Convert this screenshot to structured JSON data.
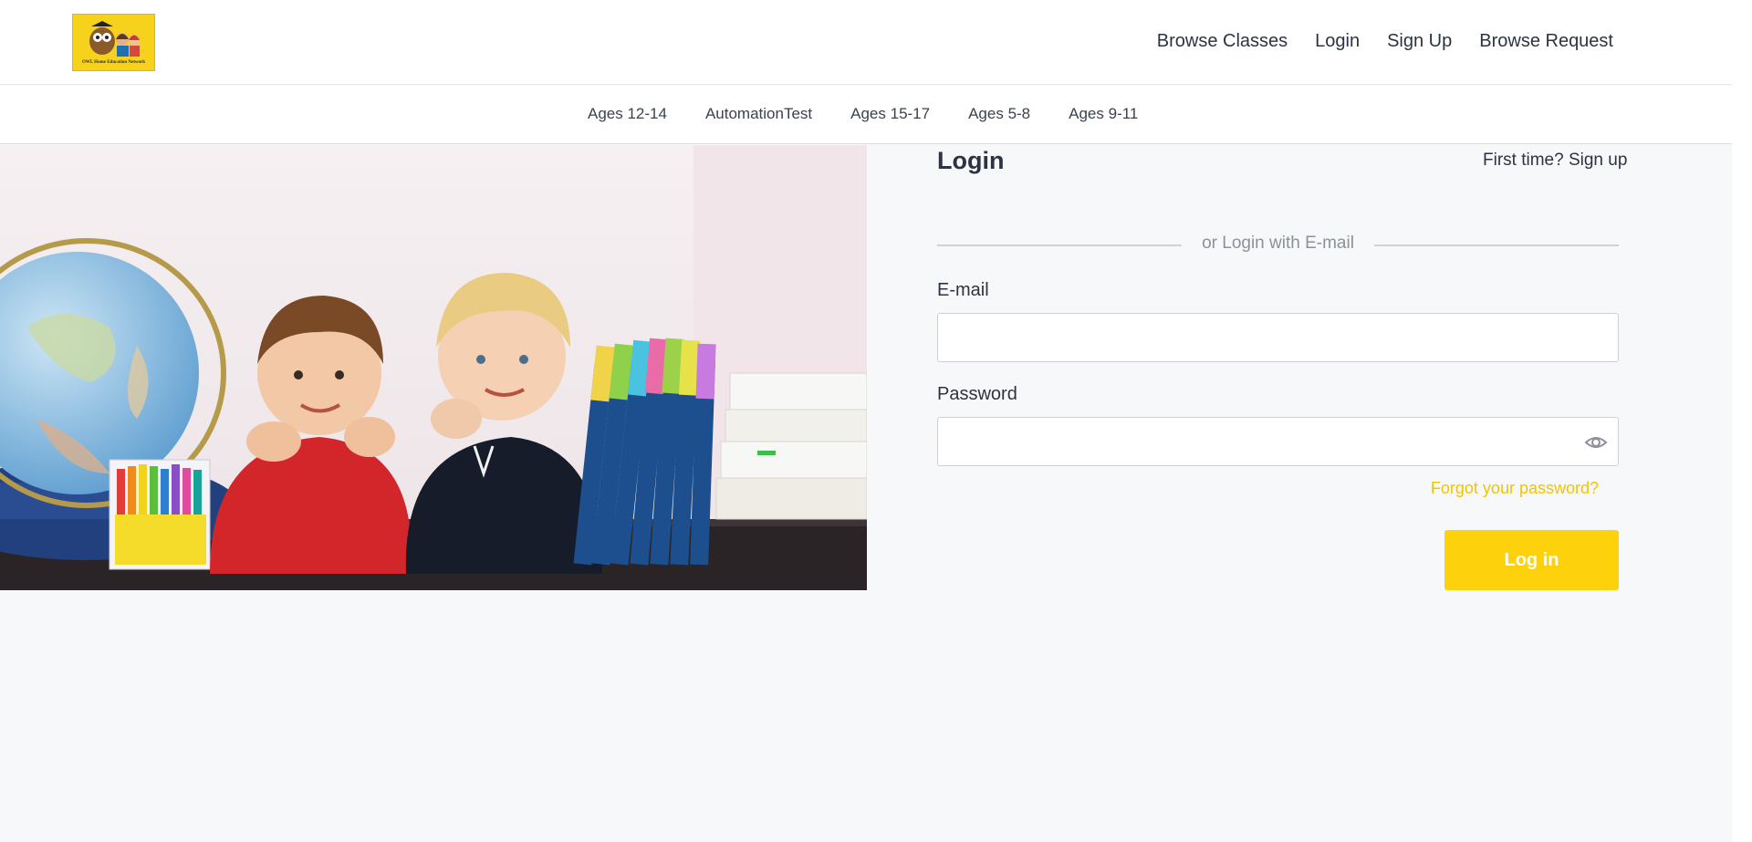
{
  "header": {
    "logo_text": "OWL Home Education Network",
    "nav": [
      "Browse Classes",
      "Login",
      "Sign Up",
      "Browse Request"
    ]
  },
  "categories": [
    "Ages 12-14",
    "AutomationTest",
    "Ages 15-17",
    "Ages 5-8",
    "Ages 9-11"
  ],
  "login": {
    "title": "Login",
    "signup_prompt": "First time? Sign up",
    "divider_text": "or Login with E-mail",
    "email_label": "E-mail",
    "email_value": "",
    "password_label": "Password",
    "password_value": "",
    "forgot_text": "Forgot your password?",
    "submit_label": "Log in"
  },
  "colors": {
    "accent": "#fdd20c",
    "link_accent": "#f2c400",
    "text": "#2d3340",
    "page_bg": "#f7f8fa"
  },
  "icons": {
    "password_toggle": "eye-icon"
  }
}
